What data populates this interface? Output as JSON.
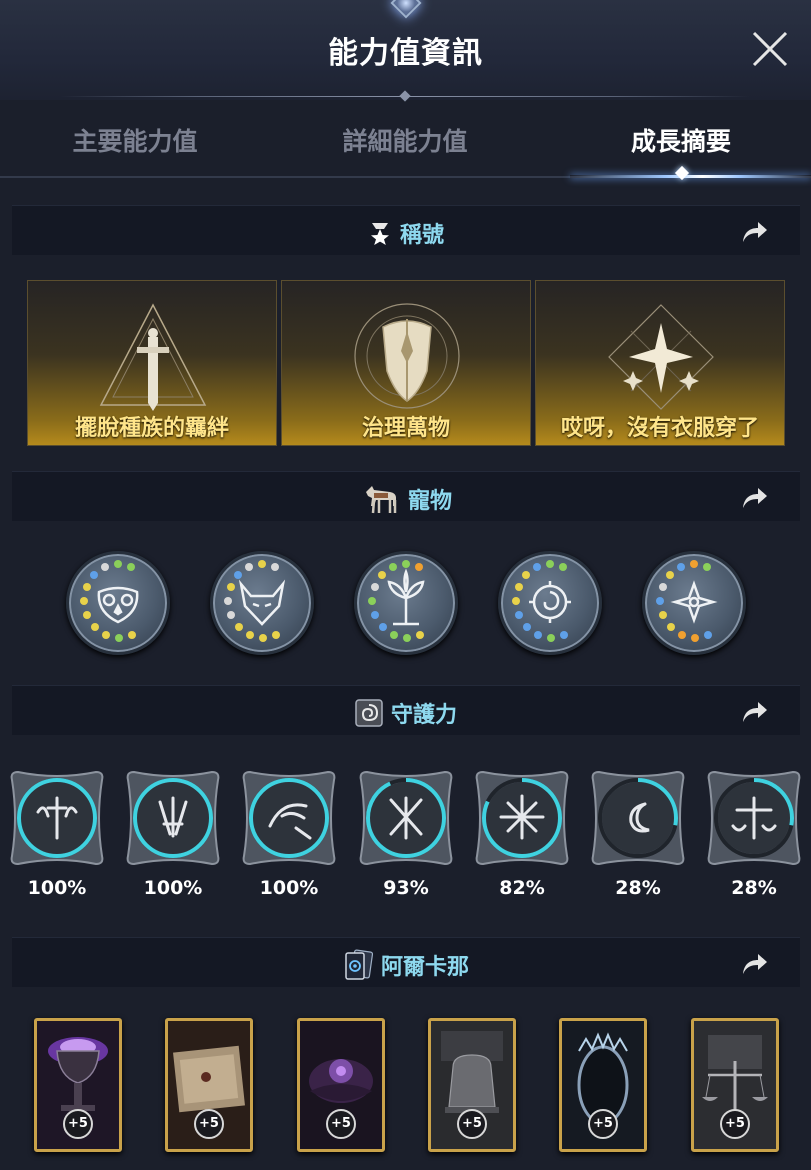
{
  "window": {
    "title": "能力值資訊"
  },
  "tabs": [
    {
      "label": "主要能力值",
      "active": false
    },
    {
      "label": "詳細能力值",
      "active": false
    },
    {
      "label": "成長摘要",
      "active": true
    }
  ],
  "sections": {
    "titles": {
      "label": "稱號",
      "icon": "medal-star-icon",
      "items": [
        {
          "label": "擺脫種族的羈絆",
          "icon": "sword-triangle-emblem"
        },
        {
          "label": "治理萬物",
          "icon": "shield-emblem"
        },
        {
          "label": "哎呀，沒有衣服穿了",
          "icon": "sparkle-stars-emblem"
        }
      ]
    },
    "pets": {
      "label": "寵物",
      "icon": "horse-icon",
      "items": [
        {
          "name": "owl-pet-icon"
        },
        {
          "name": "wolf-pet-icon"
        },
        {
          "name": "tree-pet-icon"
        },
        {
          "name": "swirl-pet-icon"
        },
        {
          "name": "flower-pet-icon"
        }
      ]
    },
    "guardian": {
      "label": "守護力",
      "icon": "spiral-rune-icon",
      "items": [
        {
          "name": "sword-wings-crest",
          "percent": "100%",
          "value": 1.0
        },
        {
          "name": "claw-blade-crest",
          "percent": "100%",
          "value": 1.0
        },
        {
          "name": "bird-arrow-crest",
          "percent": "100%",
          "value": 1.0
        },
        {
          "name": "crossed-blades-crest",
          "percent": "93%",
          "value": 0.93
        },
        {
          "name": "sun-star-crest",
          "percent": "82%",
          "value": 0.82
        },
        {
          "name": "moon-crest",
          "percent": "28%",
          "value": 0.28
        },
        {
          "name": "scales-crest",
          "percent": "28%",
          "value": 0.28
        }
      ]
    },
    "arcana": {
      "label": "阿爾卡那",
      "icon": "card-deck-icon",
      "items": [
        {
          "name": "chalice-card",
          "level": "+5"
        },
        {
          "name": "scroll-card",
          "level": "+5"
        },
        {
          "name": "dark-flower-card",
          "level": "+5"
        },
        {
          "name": "bell-card",
          "level": "+5"
        },
        {
          "name": "mirror-card",
          "level": "+5"
        },
        {
          "name": "scales-card",
          "level": "+5"
        }
      ]
    }
  },
  "colors": {
    "background": "#1b1f2b",
    "section_title": "#8ed9ef",
    "title_label": "#ffe58a",
    "progress_ring": "#3fd2e0",
    "card_border": "#c9a24a"
  }
}
